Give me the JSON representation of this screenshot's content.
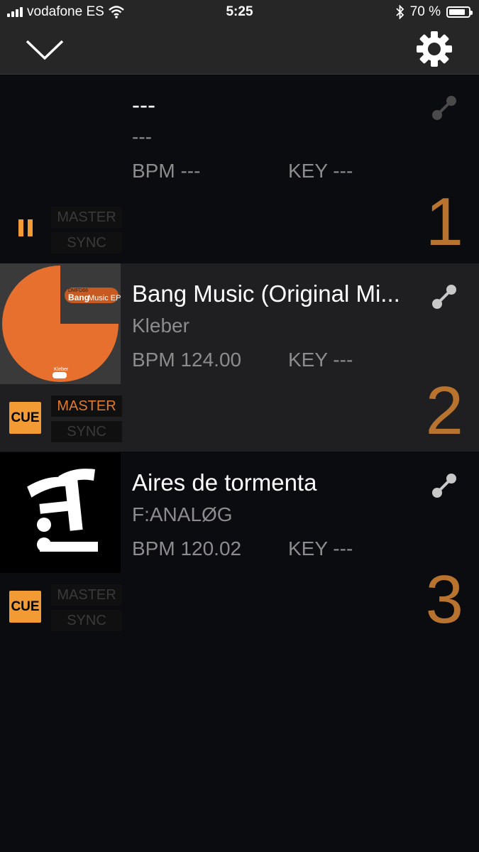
{
  "status_bar": {
    "carrier": "vodafone ES",
    "time": "5:25",
    "battery": "70 %",
    "battery_level": 0.7
  },
  "nav": {
    "collapse_icon": "chevron-down-icon",
    "settings_icon": "gear-icon"
  },
  "decks": [
    {
      "number": "1",
      "title": "---",
      "artist": "---",
      "bpm": "BPM ---",
      "key": "KEY ---",
      "master": "MASTER",
      "sync": "SYNC",
      "play_state": "pause-icon",
      "master_active": false
    },
    {
      "number": "2",
      "title": "Bang Music (Original Mi...",
      "artist": "Kleber",
      "bpm": "BPM 124.00",
      "key": "KEY ---",
      "master": "MASTER",
      "sync": "SYNC",
      "cue": "CUE",
      "master_active": true,
      "art": {
        "label_code": "DMFD66",
        "label_title": "Bang",
        "label_subtitle": "Music EP",
        "label_artist": "Kleber",
        "colors": {
          "record": "#e8702e",
          "background": "#3a3a3a"
        }
      }
    },
    {
      "number": "3",
      "title": "Aires de tormenta",
      "artist": "F:ANALØG",
      "bpm": "BPM 120.02",
      "key": "KEY ---",
      "master": "MASTER",
      "sync": "SYNC",
      "cue": "CUE",
      "master_active": false
    }
  ],
  "colors": {
    "accent": "#f29a34",
    "deck_number": "#b8742e",
    "master_on": "#e07a2e",
    "background": "#0b0c10",
    "active_deck": "#1f1f21"
  }
}
